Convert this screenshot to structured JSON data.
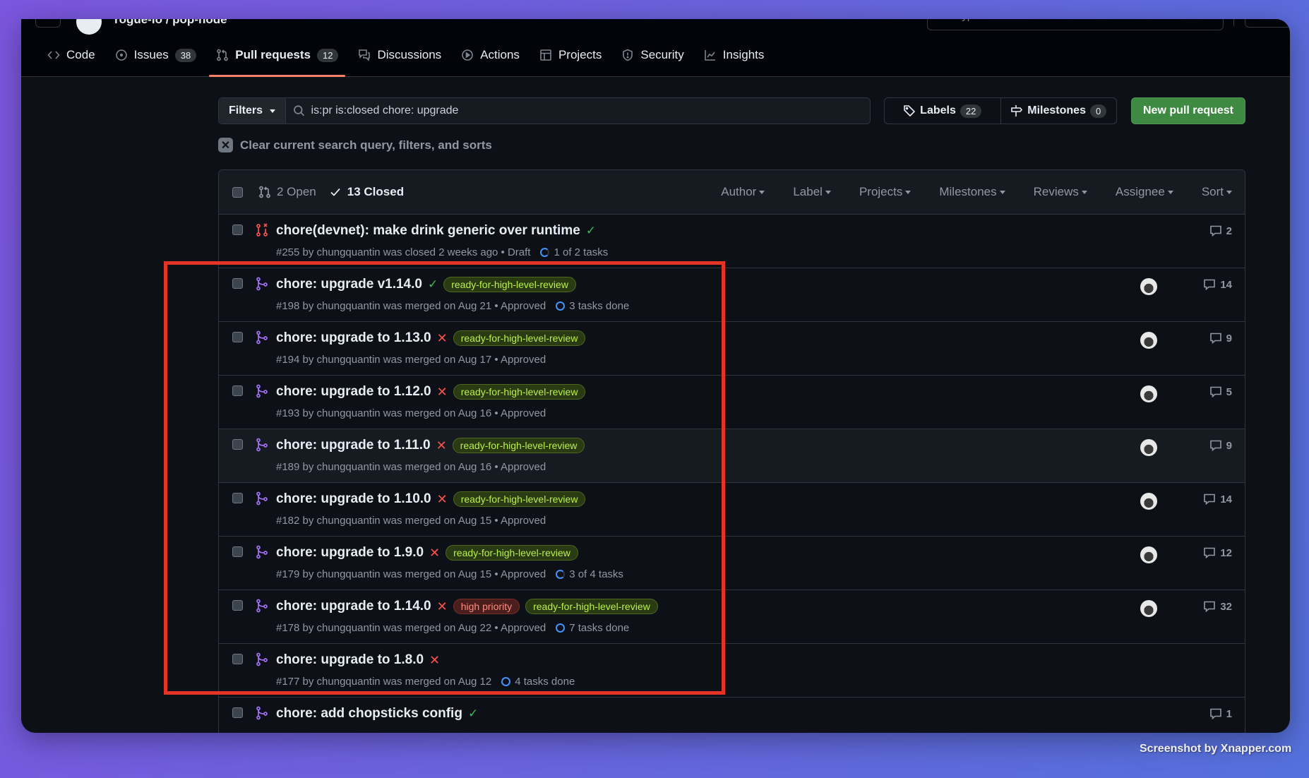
{
  "header": {
    "repo_path": "rogue-io / pop-node",
    "search_placeholder": "Type / to search"
  },
  "nav": {
    "tabs": [
      {
        "label": "Code",
        "icon": "code-icon"
      },
      {
        "label": "Issues",
        "icon": "issue-icon",
        "count": "38"
      },
      {
        "label": "Pull requests",
        "icon": "pull-request-icon",
        "count": "12",
        "active": true
      },
      {
        "label": "Discussions",
        "icon": "discussion-icon"
      },
      {
        "label": "Actions",
        "icon": "play-icon"
      },
      {
        "label": "Projects",
        "icon": "table-icon"
      },
      {
        "label": "Security",
        "icon": "shield-icon"
      },
      {
        "label": "Insights",
        "icon": "graph-icon"
      }
    ]
  },
  "toolbar": {
    "filters_label": "Filters",
    "search_value": "is:pr is:closed chore: upgrade",
    "labels_label": "Labels",
    "labels_count": "22",
    "milestones_label": "Milestones",
    "milestones_count": "0",
    "new_pr_label": "New pull request",
    "clear_label": "Clear current search query, filters, and sorts"
  },
  "list_header": {
    "open_label": "2 Open",
    "closed_label": "13 Closed",
    "sorters": [
      "Author",
      "Label",
      "Projects",
      "Milestones",
      "Reviews",
      "Assignee",
      "Sort"
    ]
  },
  "pull_requests": [
    {
      "title": "chore(devnet): make drink generic over runtime",
      "state": "closed",
      "status": "success",
      "labels": [],
      "meta": "#255 by chungquantin was closed 2 weeks ago • Draft",
      "tasks": "1 of 2 tasks",
      "tasks_partial": true,
      "avatar": false,
      "comments": "2"
    },
    {
      "title": "chore: upgrade v1.14.0",
      "state": "merged",
      "status": "success",
      "labels": [
        {
          "name": "ready-for-high-level-review",
          "color": "green"
        }
      ],
      "meta": "#198 by chungquantin was merged on Aug 21 • Approved",
      "tasks": "3 tasks done",
      "tasks_partial": false,
      "avatar": true,
      "comments": "14"
    },
    {
      "title": "chore: upgrade to 1.13.0",
      "state": "merged",
      "status": "failure",
      "labels": [
        {
          "name": "ready-for-high-level-review",
          "color": "green"
        }
      ],
      "meta": "#194 by chungquantin was merged on Aug 17 • Approved",
      "tasks": "",
      "avatar": true,
      "comments": "9"
    },
    {
      "title": "chore: upgrade to 1.12.0",
      "state": "merged",
      "status": "failure",
      "labels": [
        {
          "name": "ready-for-high-level-review",
          "color": "green"
        }
      ],
      "meta": "#193 by chungquantin was merged on Aug 16 • Approved",
      "tasks": "",
      "avatar": true,
      "comments": "5"
    },
    {
      "title": "chore: upgrade to 1.11.0",
      "state": "merged",
      "status": "failure",
      "labels": [
        {
          "name": "ready-for-high-level-review",
          "color": "green"
        }
      ],
      "meta": "#189 by chungquantin was merged on Aug 16 • Approved",
      "tasks": "",
      "avatar": true,
      "comments": "9",
      "hover": true
    },
    {
      "title": "chore: upgrade to 1.10.0",
      "state": "merged",
      "status": "failure",
      "labels": [
        {
          "name": "ready-for-high-level-review",
          "color": "green"
        }
      ],
      "meta": "#182 by chungquantin was merged on Aug 15 • Approved",
      "tasks": "",
      "avatar": true,
      "comments": "14"
    },
    {
      "title": "chore: upgrade to 1.9.0",
      "state": "merged",
      "status": "failure",
      "labels": [
        {
          "name": "ready-for-high-level-review",
          "color": "green"
        }
      ],
      "meta": "#179 by chungquantin was merged on Aug 15 • Approved",
      "tasks": "3 of 4 tasks",
      "tasks_partial": true,
      "avatar": true,
      "comments": "12"
    },
    {
      "title": "chore: upgrade to 1.14.0",
      "state": "merged",
      "status": "failure",
      "labels": [
        {
          "name": "high priority",
          "color": "red"
        },
        {
          "name": "ready-for-high-level-review",
          "color": "green"
        }
      ],
      "meta": "#178 by chungquantin was merged on Aug 22 • Approved",
      "tasks": "7 tasks done",
      "tasks_partial": false,
      "avatar": true,
      "comments": "32"
    },
    {
      "title": "chore: upgrade to 1.8.0",
      "state": "merged",
      "status": "failure",
      "labels": [],
      "meta": "#177 by chungquantin was merged on Aug 12",
      "tasks": "4 tasks done",
      "tasks_partial": false,
      "avatar": false,
      "comments": ""
    },
    {
      "title": "chore: add chopsticks config",
      "state": "merged",
      "status": "success",
      "labels": [],
      "meta": "",
      "tasks": "",
      "avatar": false,
      "comments": "1"
    }
  ],
  "colors": {
    "merged": "#a371f7",
    "closed": "#f85149",
    "success": "#3fb950",
    "failure": "#f85149",
    "primary_button": "#3f8a42",
    "highlight_box": "#e53326"
  },
  "credit": "Screenshot by Xnapper.com"
}
